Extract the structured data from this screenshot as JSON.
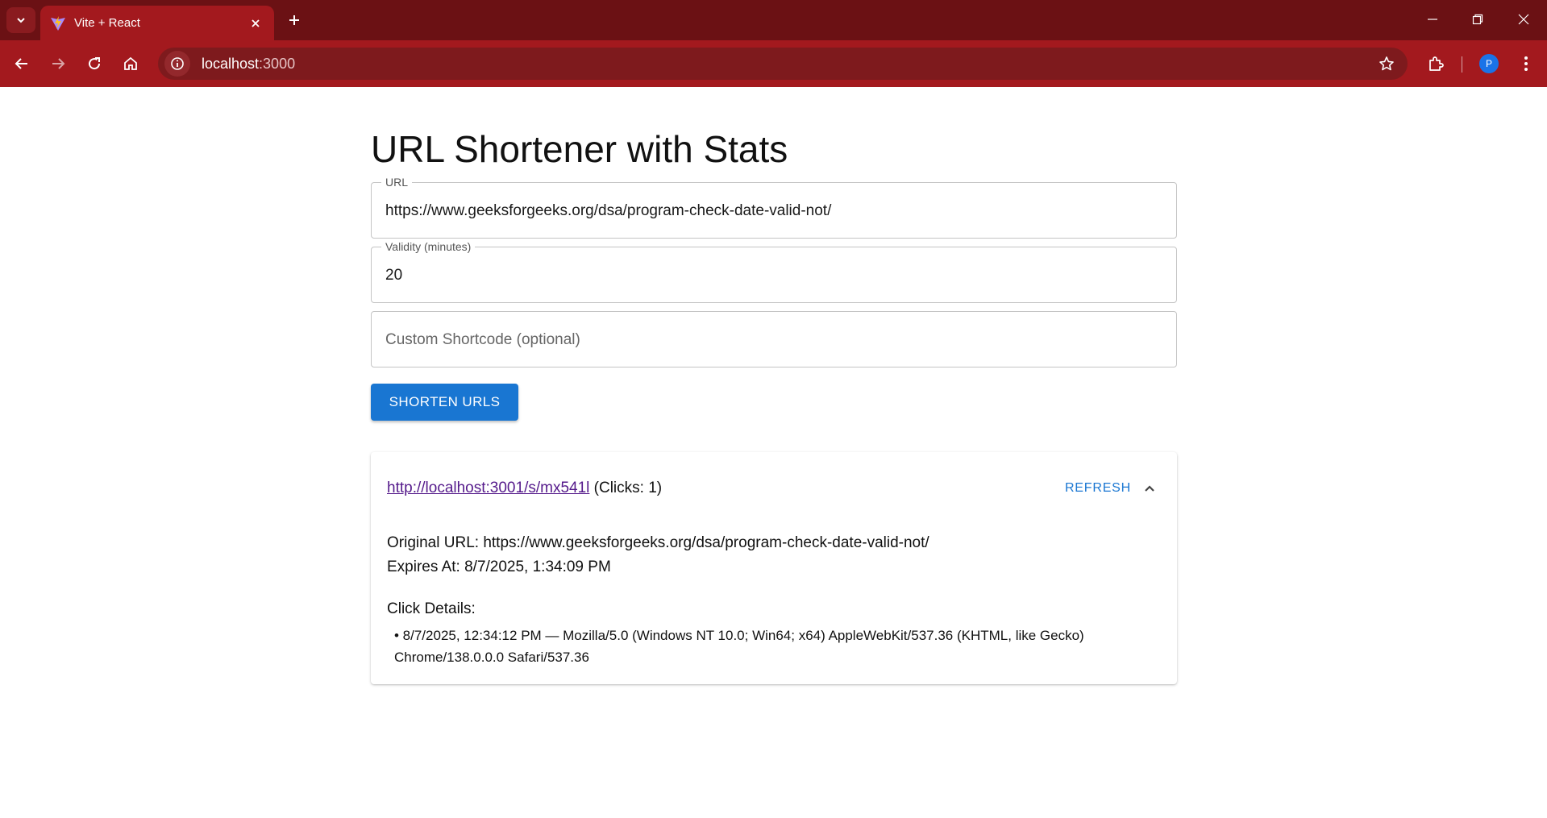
{
  "browser": {
    "tab_title": "Vite + React",
    "address_host": "localhost",
    "address_port": ":3000",
    "profile_initial": "P"
  },
  "page": {
    "title": "URL Shortener with Stats",
    "url_field": {
      "label": "URL",
      "value": "https://www.geeksforgeeks.org/dsa/program-check-date-valid-not/"
    },
    "validity_field": {
      "label": "Validity (minutes)",
      "value": "20"
    },
    "shortcode_field": {
      "placeholder": "Custom Shortcode (optional)"
    },
    "shorten_button": "SHORTEN URLS",
    "result": {
      "short_url": "http://localhost:3001/s/mx541l",
      "clicks_text": "(Clicks: 1)",
      "refresh_label": "REFRESH",
      "original_url_line": "Original URL: https://www.geeksforgeeks.org/dsa/program-check-date-valid-not/",
      "expires_line": "Expires At: 8/7/2025, 1:34:09 PM",
      "click_details_heading": "Click Details:",
      "clicks": [
        "• 8/7/2025, 12:34:12 PM — Mozilla/5.0 (Windows NT 10.0; Win64; x64) AppleWebKit/537.36 (KHTML, like Gecko) Chrome/138.0.0.0 Safari/537.36"
      ]
    }
  },
  "colors": {
    "chrome_dark": "#6b1114",
    "chrome_toolbar": "#a3191e",
    "primary_button": "#1976d2",
    "visited_link": "#551a8b"
  }
}
